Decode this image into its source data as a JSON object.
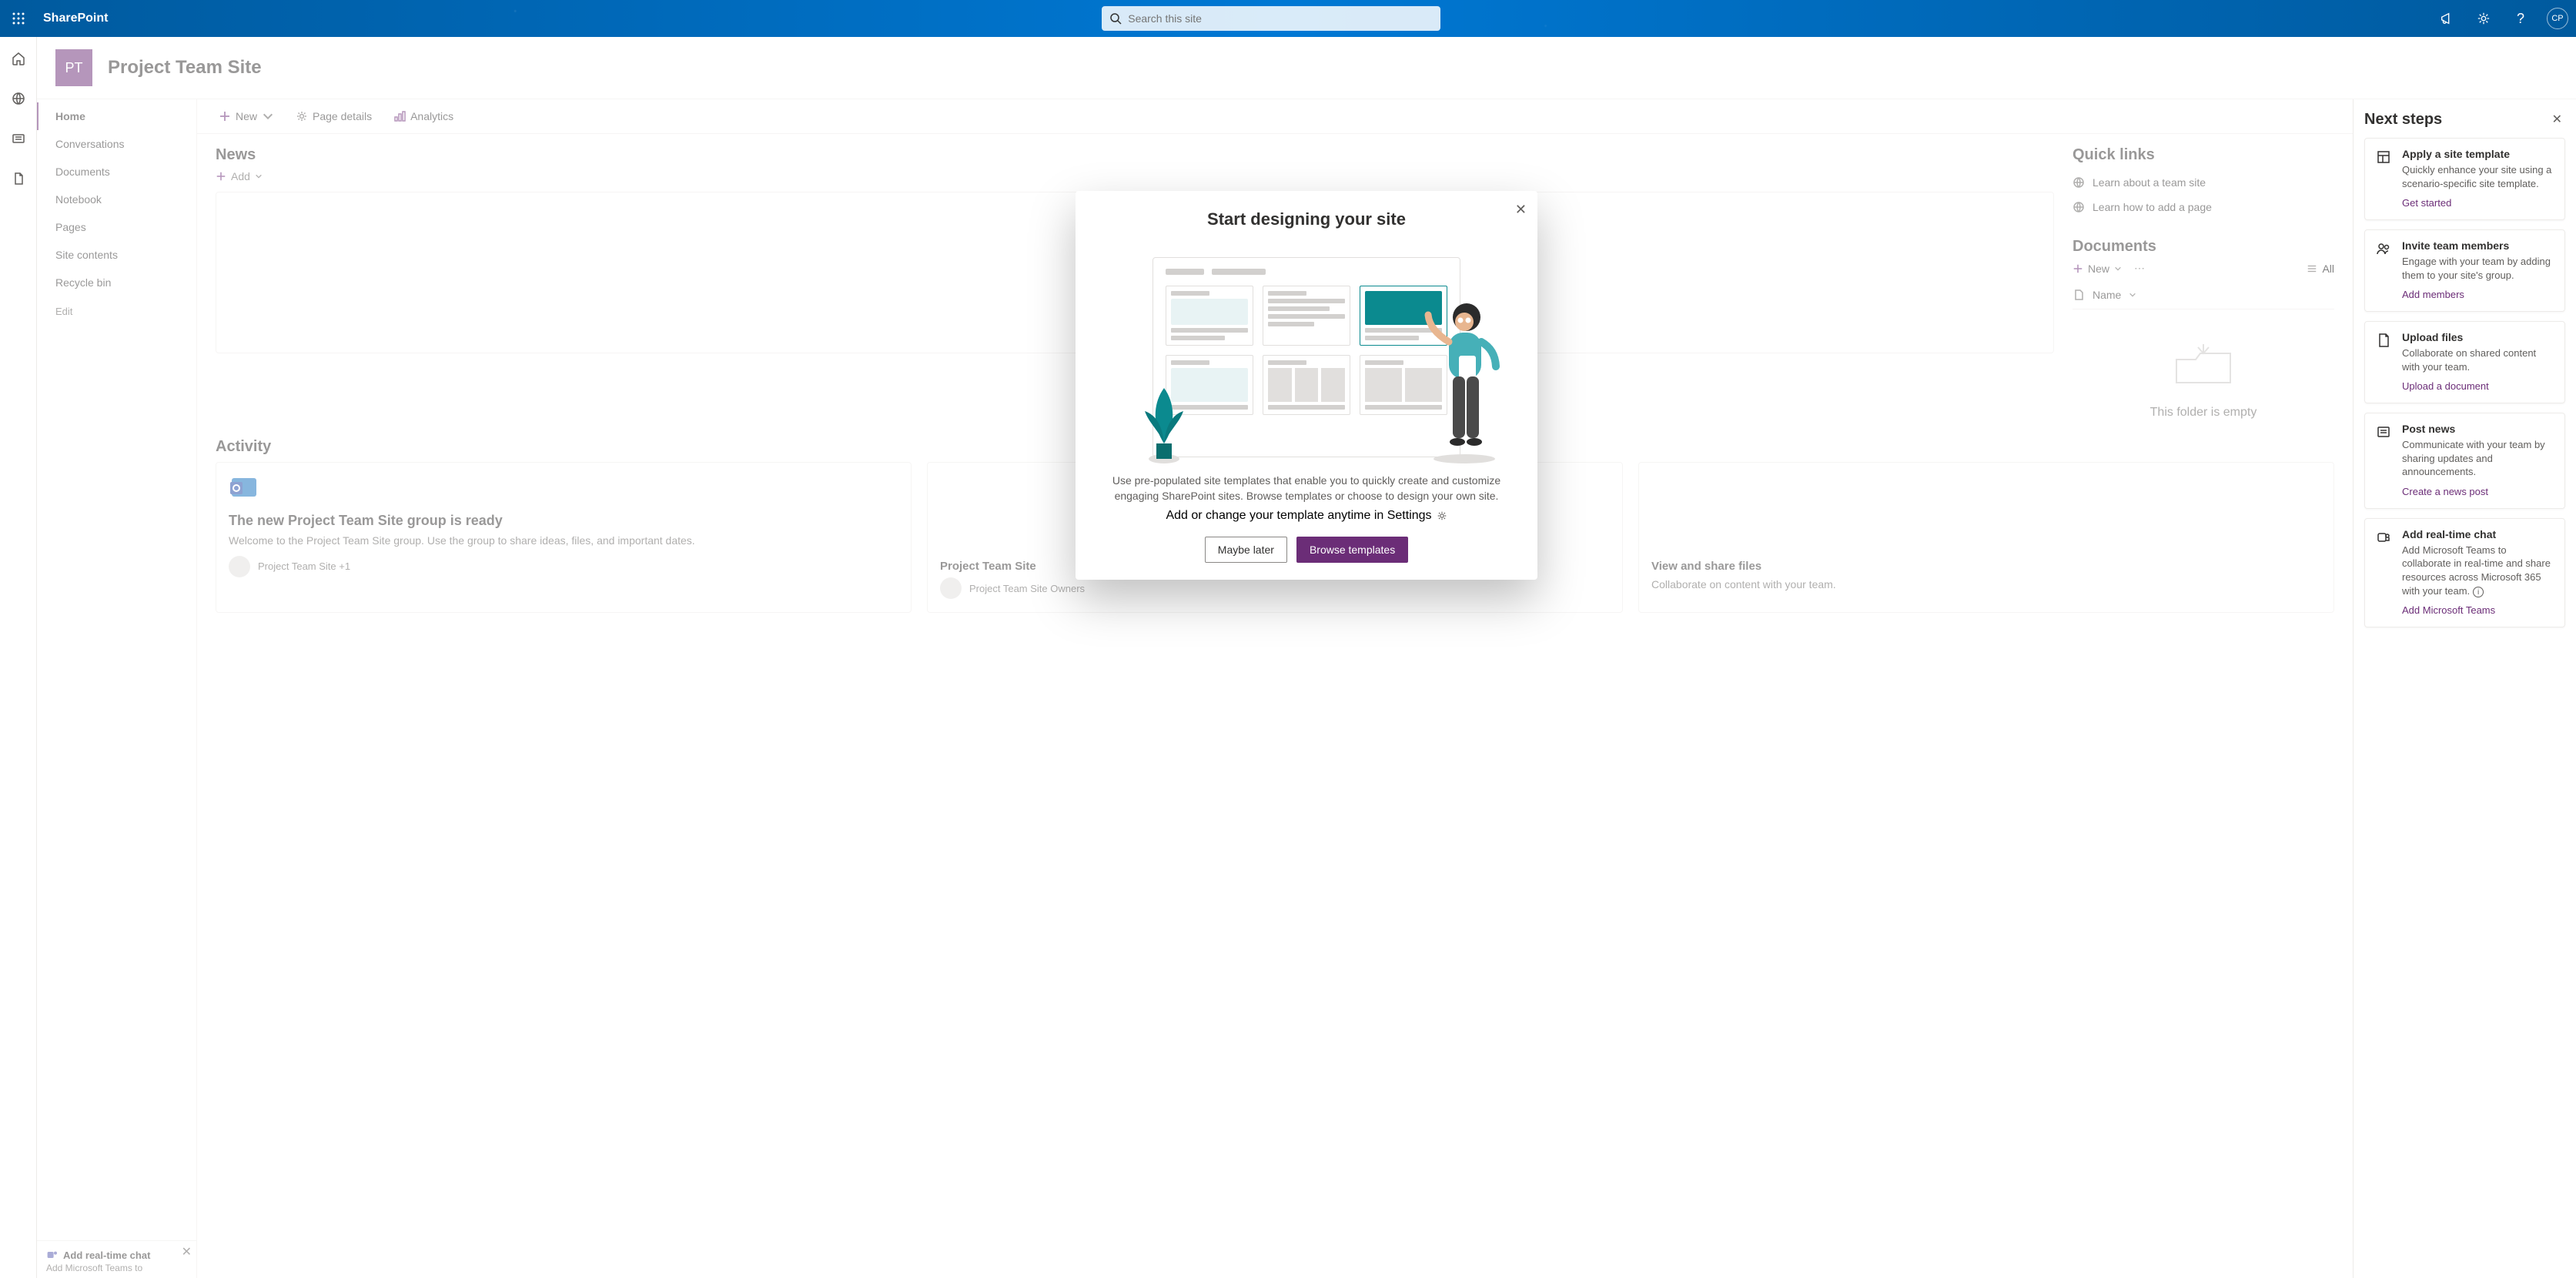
{
  "suite": {
    "app_name": "SharePoint",
    "search_placeholder": "Search this site",
    "avatar_initials": "CP"
  },
  "site": {
    "logo_initials": "PT",
    "title": "Project Team Site"
  },
  "nav": {
    "items": [
      "Home",
      "Conversations",
      "Documents",
      "Notebook",
      "Pages",
      "Site contents",
      "Recycle bin"
    ],
    "edit_label": "Edit"
  },
  "cmd": {
    "new": "New",
    "page_details": "Page details",
    "analytics": "Analytics"
  },
  "news": {
    "title": "News",
    "add": "Add"
  },
  "quicklinks": {
    "title": "Quick links",
    "items": [
      "Learn about a team site",
      "Learn how to add a page"
    ]
  },
  "documents": {
    "title": "Documents",
    "new": "New",
    "all": "All",
    "name_col": "Name",
    "empty": "This folder is empty"
  },
  "activity": {
    "title": "Activity",
    "cards": [
      {
        "title": "The new Project Team Site group is ready",
        "text": "Welcome to the Project Team Site group. Use the group to share ideas, files, and important dates.",
        "meta": "Project Team Site +1"
      },
      {
        "title": "Project Team Site",
        "text": "",
        "meta": "Project Team Site Owners"
      },
      {
        "title": "View and share files",
        "text": "Collaborate on content with your team.",
        "meta": ""
      }
    ]
  },
  "chat": {
    "title": "Add real-time chat",
    "sub": "Add Microsoft Teams to"
  },
  "modal": {
    "title": "Start designing your site",
    "body": "Use pre-populated site templates that enable you to quickly create and customize engaging SharePoint sites. Browse templates or choose to design your own site.",
    "settings_line": "Add or change your template anytime in Settings",
    "later": "Maybe later",
    "browse": "Browse templates"
  },
  "next": {
    "title": "Next steps",
    "cards": [
      {
        "h": "Apply a site template",
        "p": "Quickly enhance your site using a scenario-specific site template.",
        "a": "Get started"
      },
      {
        "h": "Invite team members",
        "p": "Engage with your team by adding them to your site's group.",
        "a": "Add members"
      },
      {
        "h": "Upload files",
        "p": "Collaborate on shared content with your team.",
        "a": "Upload a document"
      },
      {
        "h": "Post news",
        "p": "Communicate with your team by sharing updates and announcements.",
        "a": "Create a news post"
      },
      {
        "h": "Add real-time chat",
        "p": "Add Microsoft Teams to collaborate in real-time and share resources across Microsoft 365 with your team.",
        "a": "Add Microsoft Teams"
      }
    ]
  }
}
